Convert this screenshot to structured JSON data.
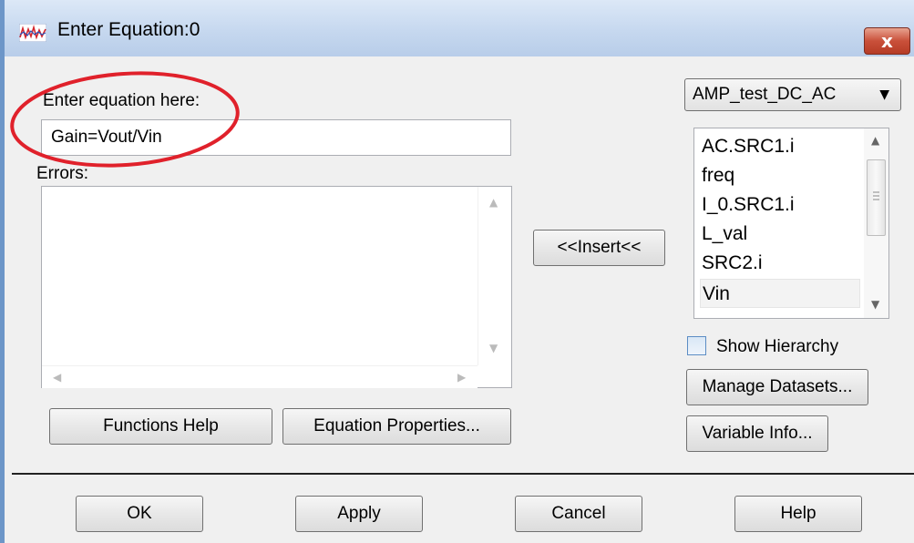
{
  "window": {
    "title": "Enter Equation:0",
    "close_label": "x"
  },
  "equation": {
    "label": "Enter equation here:",
    "value": "Gain=Vout/Vin"
  },
  "errors": {
    "label": "Errors:"
  },
  "buttons": {
    "functions_help": "Functions Help",
    "equation_properties": "Equation Properties...",
    "insert": "<<Insert<<",
    "manage_datasets": "Manage Datasets...",
    "variable_info": "Variable Info...",
    "ok": "OK",
    "apply": "Apply",
    "cancel": "Cancel",
    "help": "Help"
  },
  "dataset": {
    "selected": "AMP_test_DC_AC"
  },
  "variables": {
    "items": [
      {
        "label": "AC.SRC1.i"
      },
      {
        "label": "freq"
      },
      {
        "label": "I_0.SRC1.i"
      },
      {
        "label": "L_val"
      },
      {
        "label": "SRC2.i"
      },
      {
        "label": "Vin"
      }
    ],
    "selected": "Vin"
  },
  "show_hierarchy": {
    "label": "Show Hierarchy",
    "checked": false
  },
  "colors": {
    "annotation": "#e0212b",
    "close_button": "#c9503a",
    "title_bar": "#c6d8ef"
  },
  "icons": {
    "app": "waveform-icon",
    "close": "close-icon"
  }
}
